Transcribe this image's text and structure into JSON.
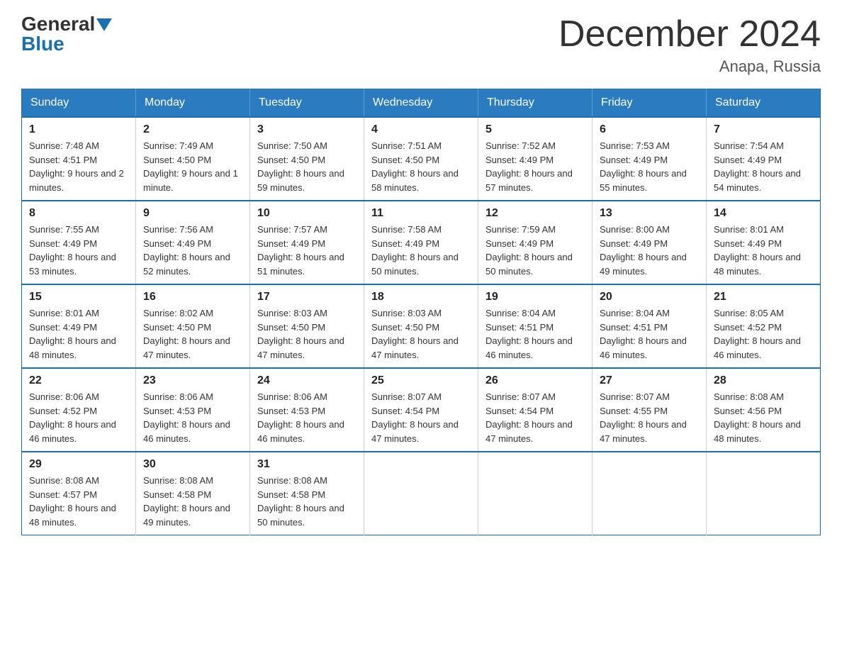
{
  "logo": {
    "general": "General",
    "blue": "Blue"
  },
  "title": "December 2024",
  "location": "Anapa, Russia",
  "days_of_week": [
    "Sunday",
    "Monday",
    "Tuesday",
    "Wednesday",
    "Thursday",
    "Friday",
    "Saturday"
  ],
  "weeks": [
    [
      {
        "day": "1",
        "sunrise": "7:48 AM",
        "sunset": "4:51 PM",
        "daylight": "9 hours and 2 minutes."
      },
      {
        "day": "2",
        "sunrise": "7:49 AM",
        "sunset": "4:50 PM",
        "daylight": "9 hours and 1 minute."
      },
      {
        "day": "3",
        "sunrise": "7:50 AM",
        "sunset": "4:50 PM",
        "daylight": "8 hours and 59 minutes."
      },
      {
        "day": "4",
        "sunrise": "7:51 AM",
        "sunset": "4:50 PM",
        "daylight": "8 hours and 58 minutes."
      },
      {
        "day": "5",
        "sunrise": "7:52 AM",
        "sunset": "4:49 PM",
        "daylight": "8 hours and 57 minutes."
      },
      {
        "day": "6",
        "sunrise": "7:53 AM",
        "sunset": "4:49 PM",
        "daylight": "8 hours and 55 minutes."
      },
      {
        "day": "7",
        "sunrise": "7:54 AM",
        "sunset": "4:49 PM",
        "daylight": "8 hours and 54 minutes."
      }
    ],
    [
      {
        "day": "8",
        "sunrise": "7:55 AM",
        "sunset": "4:49 PM",
        "daylight": "8 hours and 53 minutes."
      },
      {
        "day": "9",
        "sunrise": "7:56 AM",
        "sunset": "4:49 PM",
        "daylight": "8 hours and 52 minutes."
      },
      {
        "day": "10",
        "sunrise": "7:57 AM",
        "sunset": "4:49 PM",
        "daylight": "8 hours and 51 minutes."
      },
      {
        "day": "11",
        "sunrise": "7:58 AM",
        "sunset": "4:49 PM",
        "daylight": "8 hours and 50 minutes."
      },
      {
        "day": "12",
        "sunrise": "7:59 AM",
        "sunset": "4:49 PM",
        "daylight": "8 hours and 50 minutes."
      },
      {
        "day": "13",
        "sunrise": "8:00 AM",
        "sunset": "4:49 PM",
        "daylight": "8 hours and 49 minutes."
      },
      {
        "day": "14",
        "sunrise": "8:01 AM",
        "sunset": "4:49 PM",
        "daylight": "8 hours and 48 minutes."
      }
    ],
    [
      {
        "day": "15",
        "sunrise": "8:01 AM",
        "sunset": "4:49 PM",
        "daylight": "8 hours and 48 minutes."
      },
      {
        "day": "16",
        "sunrise": "8:02 AM",
        "sunset": "4:50 PM",
        "daylight": "8 hours and 47 minutes."
      },
      {
        "day": "17",
        "sunrise": "8:03 AM",
        "sunset": "4:50 PM",
        "daylight": "8 hours and 47 minutes."
      },
      {
        "day": "18",
        "sunrise": "8:03 AM",
        "sunset": "4:50 PM",
        "daylight": "8 hours and 47 minutes."
      },
      {
        "day": "19",
        "sunrise": "8:04 AM",
        "sunset": "4:51 PM",
        "daylight": "8 hours and 46 minutes."
      },
      {
        "day": "20",
        "sunrise": "8:04 AM",
        "sunset": "4:51 PM",
        "daylight": "8 hours and 46 minutes."
      },
      {
        "day": "21",
        "sunrise": "8:05 AM",
        "sunset": "4:52 PM",
        "daylight": "8 hours and 46 minutes."
      }
    ],
    [
      {
        "day": "22",
        "sunrise": "8:06 AM",
        "sunset": "4:52 PM",
        "daylight": "8 hours and 46 minutes."
      },
      {
        "day": "23",
        "sunrise": "8:06 AM",
        "sunset": "4:53 PM",
        "daylight": "8 hours and 46 minutes."
      },
      {
        "day": "24",
        "sunrise": "8:06 AM",
        "sunset": "4:53 PM",
        "daylight": "8 hours and 46 minutes."
      },
      {
        "day": "25",
        "sunrise": "8:07 AM",
        "sunset": "4:54 PM",
        "daylight": "8 hours and 47 minutes."
      },
      {
        "day": "26",
        "sunrise": "8:07 AM",
        "sunset": "4:54 PM",
        "daylight": "8 hours and 47 minutes."
      },
      {
        "day": "27",
        "sunrise": "8:07 AM",
        "sunset": "4:55 PM",
        "daylight": "8 hours and 47 minutes."
      },
      {
        "day": "28",
        "sunrise": "8:08 AM",
        "sunset": "4:56 PM",
        "daylight": "8 hours and 48 minutes."
      }
    ],
    [
      {
        "day": "29",
        "sunrise": "8:08 AM",
        "sunset": "4:57 PM",
        "daylight": "8 hours and 48 minutes."
      },
      {
        "day": "30",
        "sunrise": "8:08 AM",
        "sunset": "4:58 PM",
        "daylight": "8 hours and 49 minutes."
      },
      {
        "day": "31",
        "sunrise": "8:08 AM",
        "sunset": "4:58 PM",
        "daylight": "8 hours and 50 minutes."
      },
      null,
      null,
      null,
      null
    ]
  ],
  "labels": {
    "sunrise": "Sunrise:",
    "sunset": "Sunset:",
    "daylight": "Daylight:"
  }
}
